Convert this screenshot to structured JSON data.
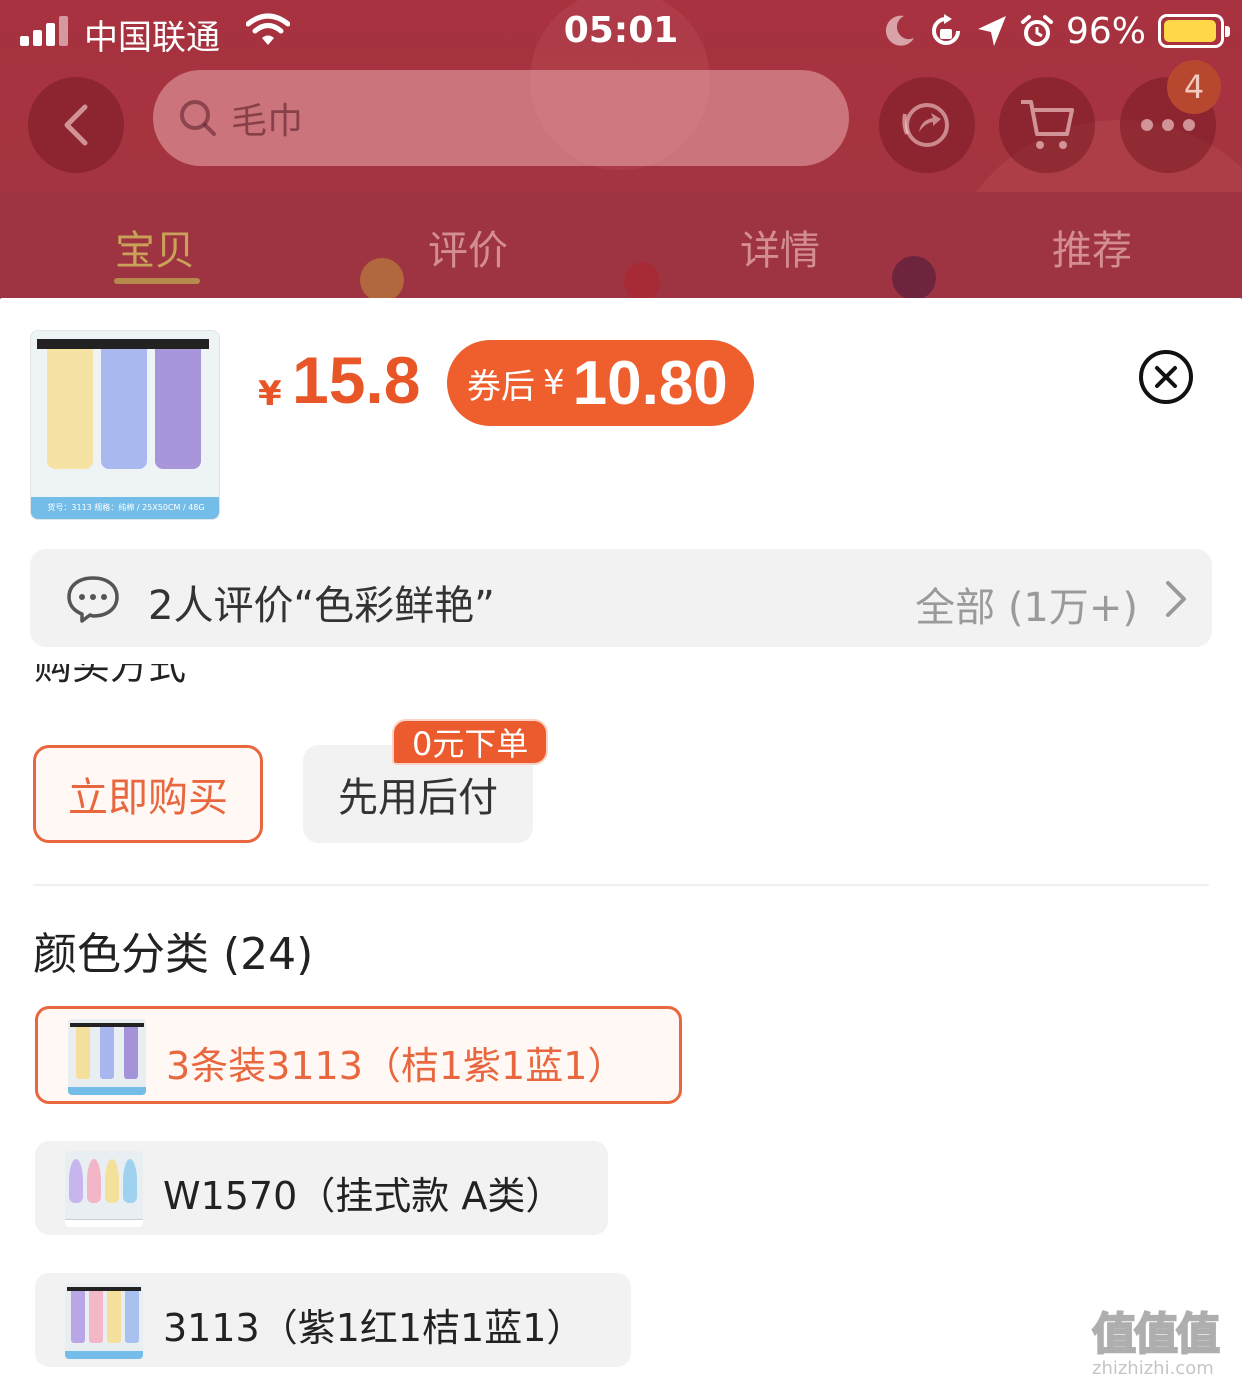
{
  "status_bar": {
    "carrier": "中国联通",
    "time": "05:01",
    "battery_pct": "96%",
    "battery_level": 0.96
  },
  "nav": {
    "search_placeholder": "毛巾",
    "more_badge": "4"
  },
  "tabs": [
    {
      "label": "宝贝",
      "active": true
    },
    {
      "label": "评价",
      "active": false
    },
    {
      "label": "详情",
      "active": false
    },
    {
      "label": "推荐",
      "active": false
    }
  ],
  "product": {
    "thumb_caption": "货号：3113  规格：纯棉 / 25X50CM / 48G",
    "currency": "¥",
    "price": "15.8",
    "coupon_label": "券后",
    "coupon_currency": "¥",
    "coupon_price": "10.80"
  },
  "review": {
    "text": "2人评价“色彩鲜艳”",
    "all": "全部 (1万+)"
  },
  "purchase": {
    "section_title": "购买方式",
    "buy_now": "立即购买",
    "pay_later": "先用后付",
    "pay_later_badge": "0元下单"
  },
  "colors": {
    "title": "颜色分类 (24)",
    "options": [
      {
        "label": "3条装3113（桔1紫1蓝1）",
        "selected": true
      },
      {
        "label": "W1570（挂式款 A类）",
        "selected": false
      },
      {
        "label": "3113（紫1红1桔1蓝1）",
        "selected": false
      }
    ]
  },
  "watermark": {
    "logo": "值值值",
    "url": "zhizhizhi.com"
  },
  "colors_theme": {
    "accent": "#e8673e",
    "price_red": "#e85527",
    "coupon_bg": "#ee5f2d",
    "header_overlay": "#a4343f"
  }
}
